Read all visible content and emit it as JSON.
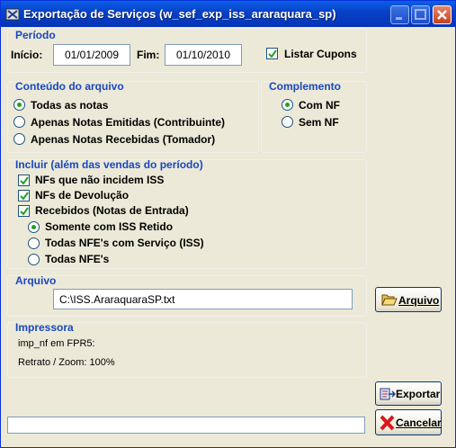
{
  "window": {
    "title": "Exportação de Serviços (w_sef_exp_iss_araraquara_sp)"
  },
  "periodo": {
    "section": "Período",
    "inicio_label": "Início:",
    "inicio_value": "01/01/2009",
    "fim_label": "Fim:",
    "fim_value": "01/10/2010",
    "listar_cupons_label": "Listar Cupons",
    "listar_cupons_checked": true
  },
  "conteudo": {
    "section": "Conteúdo do arquivo",
    "options": [
      "Todas as notas",
      "Apenas Notas Emitidas (Contribuinte)",
      "Apenas Notas Recebidas (Tomador)"
    ],
    "selected": "Todas as notas"
  },
  "complemento": {
    "section": "Complemento",
    "options": [
      "Com NF",
      "Sem NF"
    ],
    "selected": "Com NF"
  },
  "incluir": {
    "section": "Incluir (além das vendas do período)",
    "checks": [
      "NFs que não incidem ISS",
      "NFs de Devolução",
      "Recebidos (Notas de Entrada)"
    ],
    "radios": [
      "Somente com ISS Retido",
      "Todas NFE's com Serviço (ISS)",
      "Todas NFE's"
    ],
    "selected": "Somente com ISS Retido"
  },
  "arquivo": {
    "section": "Arquivo",
    "path": "C:\\ISS.AraraquaraSP.txt",
    "button": "Arquivo"
  },
  "impressora": {
    "section": "Impressora",
    "line1": "imp_nf em FPR5:",
    "line2": "Retrato / Zoom: 100%"
  },
  "buttons": {
    "exportar": "Exportar",
    "cancelar": "Cancelar"
  },
  "colors": {
    "titlebar": "#0842c8",
    "section_text": "#1848c0",
    "radio_dot": "#21a121",
    "check_mark": "#21a121"
  }
}
